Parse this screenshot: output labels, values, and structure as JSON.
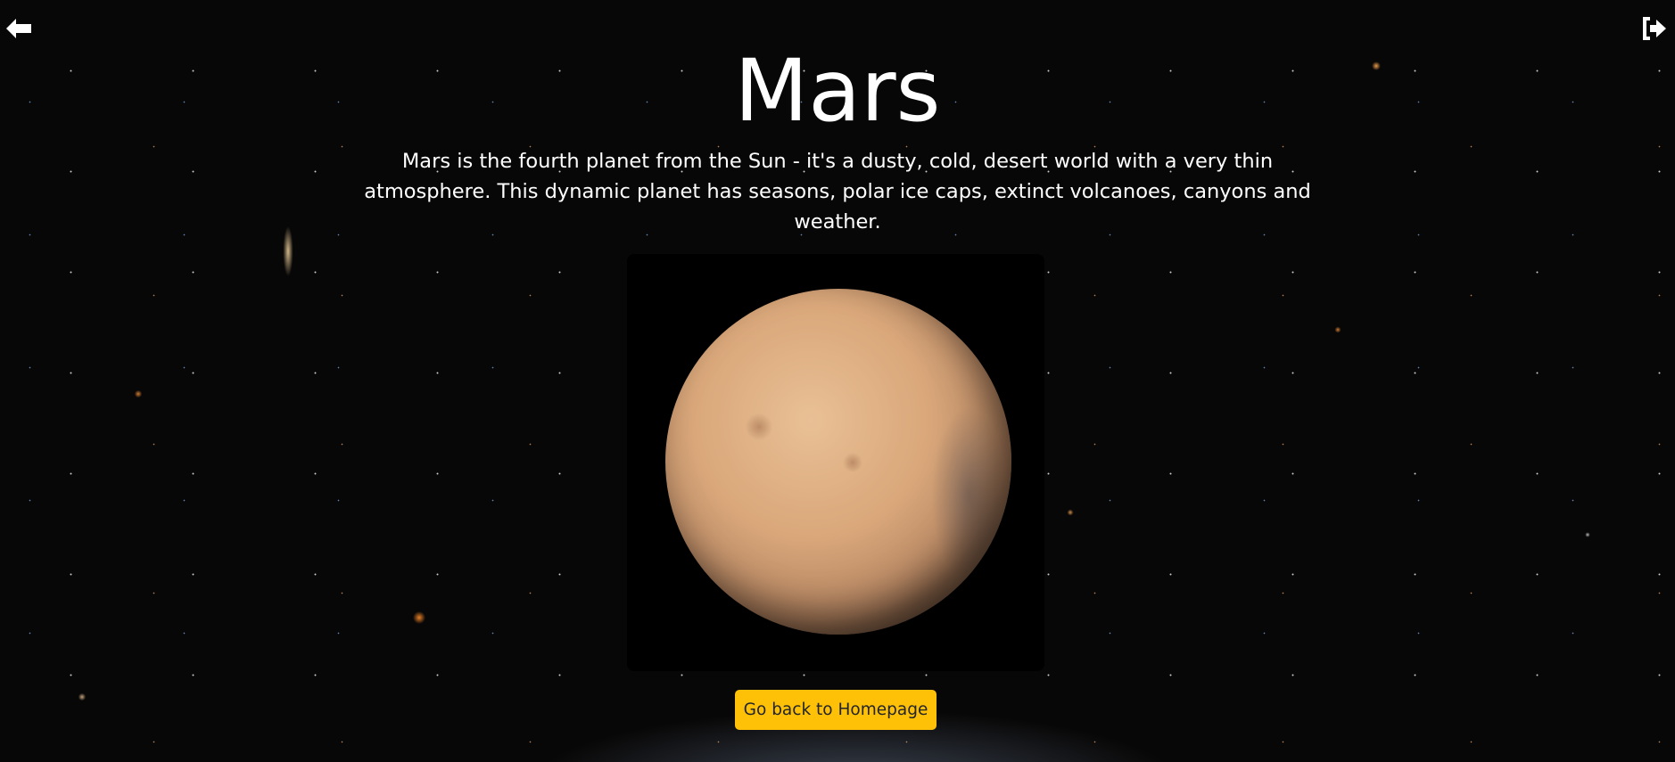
{
  "planet": {
    "title": "Mars",
    "description": "Mars is the fourth planet from the Sun - it's a dusty, cold, desert world with a very thin atmosphere. This dynamic planet has seasons, polar ice caps, extinct volcanoes, canyons and weather."
  },
  "nav": {
    "back_icon": "arrow-left-icon",
    "logout_icon": "sign-out-icon"
  },
  "actions": {
    "home_button": "Go back to Homepage"
  },
  "colors": {
    "button": "#ffc107",
    "button_text": "#212529"
  }
}
